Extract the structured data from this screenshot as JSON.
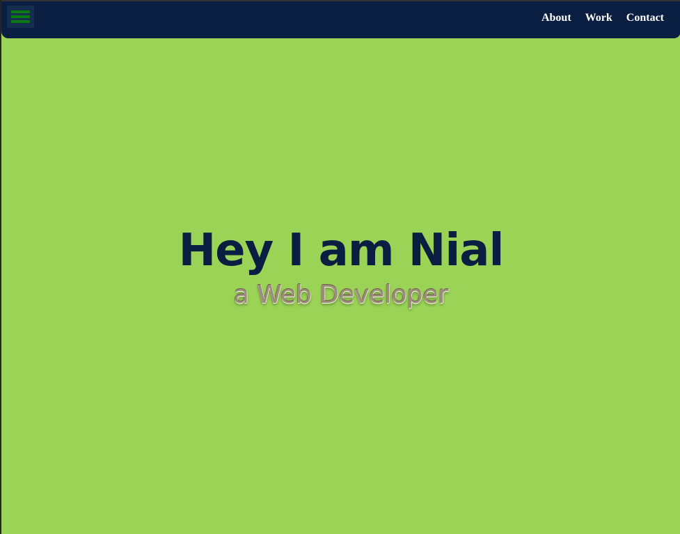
{
  "nav": {
    "links": [
      {
        "label": "About"
      },
      {
        "label": "Work"
      },
      {
        "label": "Contact"
      }
    ]
  },
  "hero": {
    "title": "Hey I am Nial",
    "subtitle": "a Web Developer"
  },
  "colors": {
    "background": "#9bd356",
    "navbar": "#0a1e42",
    "title": "#0a1e42",
    "menu_icon": "#0b7a15",
    "subtitle": "#9b8d76"
  },
  "icons": {
    "menu": "hamburger-menu-icon"
  }
}
